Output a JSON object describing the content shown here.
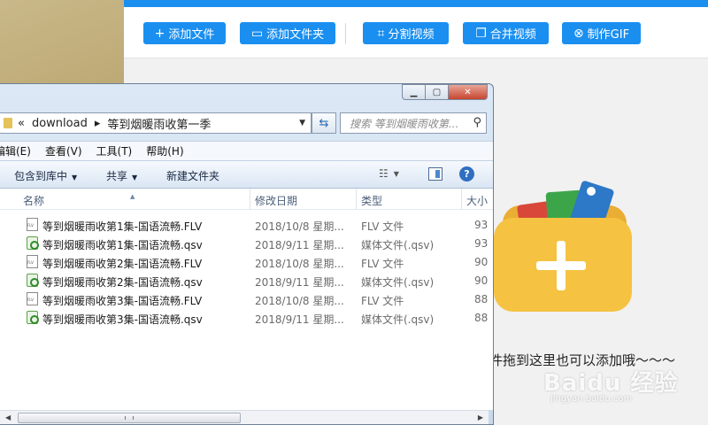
{
  "app": {
    "toolbar": {
      "buttons": [
        {
          "label": "添加文件",
          "icon": "plus-icon",
          "glyph": "+"
        },
        {
          "label": "添加文件夹",
          "icon": "folder-icon",
          "glyph": "▭"
        },
        {
          "label": "分割视频",
          "icon": "crop-icon",
          "glyph": "⌗"
        },
        {
          "label": "合并视频",
          "icon": "merge-icon",
          "glyph": "❐"
        },
        {
          "label": "制作GIF",
          "icon": "link-icon",
          "glyph": "⊗"
        }
      ]
    },
    "drop_hint": "件拖到这里也可以添加哦～～～",
    "watermark": "Baidu 经验",
    "watermark_sub": "jingyan.baidu.com",
    "accent_color": "#1a8ff0",
    "folder_color": "#f5c242"
  },
  "explorer": {
    "address": {
      "prefix": "«",
      "segments": [
        "download",
        "等到烟暖雨收第一季"
      ]
    },
    "search_placeholder": "搜索 等到烟暖雨收第...",
    "menu": [
      "编辑(E)",
      "查看(V)",
      "工具(T)",
      "帮助(H)"
    ],
    "commands": {
      "include": "包含到库中",
      "share": "共享",
      "new_folder": "新建文件夹"
    },
    "columns": {
      "name": "名称",
      "date": "修改日期",
      "type": "类型",
      "size": "大小"
    },
    "files": [
      {
        "name": "等到烟暖雨收第1集-国语流畅.FLV",
        "date": "2018/10/8 星期...",
        "type": "FLV 文件",
        "size": "93",
        "kind": "flv"
      },
      {
        "name": "等到烟暖雨收第1集-国语流畅.qsv",
        "date": "2018/9/11 星期...",
        "type": "媒体文件(.qsv)",
        "size": "93",
        "kind": "qsv"
      },
      {
        "name": "等到烟暖雨收第2集-国语流畅.FLV",
        "date": "2018/10/8 星期...",
        "type": "FLV 文件",
        "size": "90",
        "kind": "flv"
      },
      {
        "name": "等到烟暖雨收第2集-国语流畅.qsv",
        "date": "2018/9/11 星期...",
        "type": "媒体文件(.qsv)",
        "size": "90",
        "kind": "qsv"
      },
      {
        "name": "等到烟暖雨收第3集-国语流畅.FLV",
        "date": "2018/10/8 星期...",
        "type": "FLV 文件",
        "size": "88",
        "kind": "flv"
      },
      {
        "name": "等到烟暖雨收第3集-国语流畅.qsv",
        "date": "2018/9/11 星期...",
        "type": "媒体文件(.qsv)",
        "size": "88",
        "kind": "qsv"
      }
    ]
  }
}
